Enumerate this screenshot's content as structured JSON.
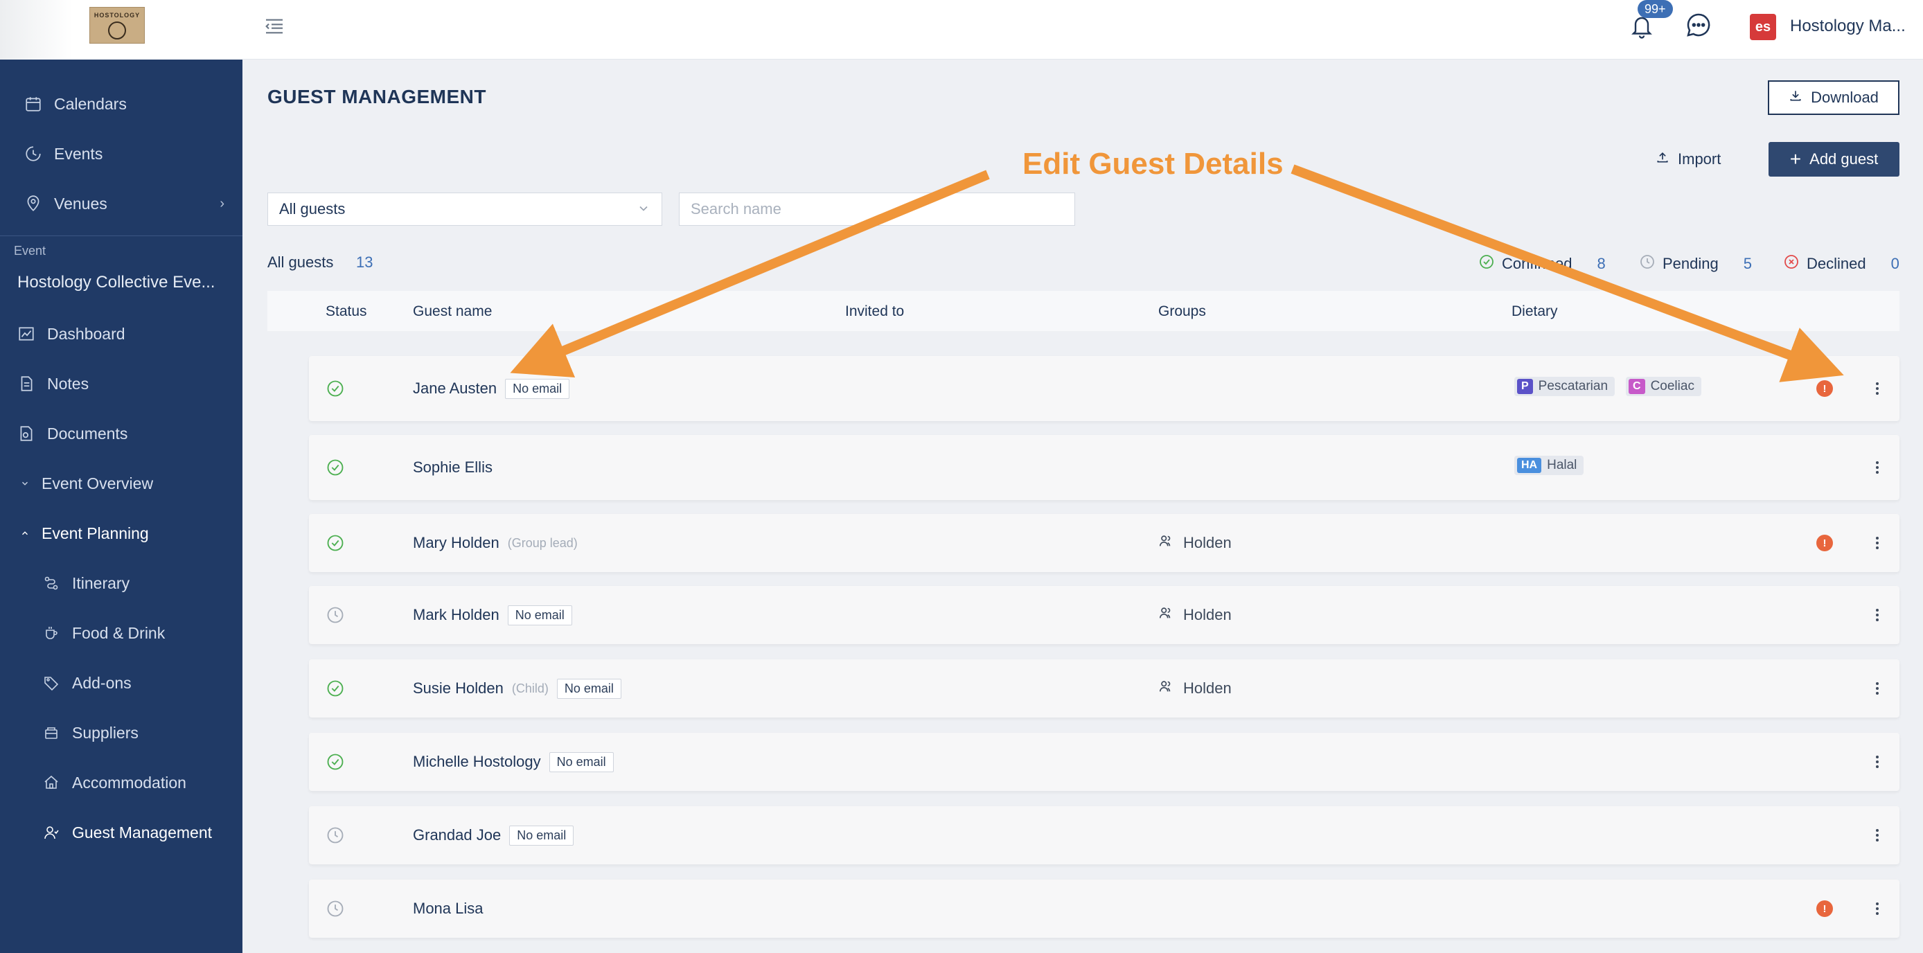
{
  "sidebar": {
    "logo_text": "HOSTOLOGY",
    "items_top": [
      {
        "label": "Calendars",
        "icon": "calendar-icon"
      },
      {
        "label": "Events",
        "icon": "events-icon"
      },
      {
        "label": "Venues",
        "icon": "location-pin-icon"
      }
    ],
    "section_label": "Event",
    "event_name": "Hostology Collective Eve...",
    "items_event": [
      {
        "label": "Dashboard"
      },
      {
        "label": "Notes"
      },
      {
        "label": "Documents"
      },
      {
        "label": "Event Overview"
      },
      {
        "label": "Event Planning"
      }
    ],
    "items_planning": [
      {
        "label": "Itinerary"
      },
      {
        "label": "Food & Drink"
      },
      {
        "label": "Add-ons"
      },
      {
        "label": "Suppliers"
      },
      {
        "label": "Accommodation"
      },
      {
        "label": "Guest Management"
      }
    ]
  },
  "topbar": {
    "notification_count": "99+",
    "user_initials": "es",
    "user_name": "Hostology Ma..."
  },
  "page": {
    "title": "GUEST MANAGEMENT",
    "download_label": "Download",
    "import_label": "Import",
    "add_label": "Add guest",
    "filter_value": "All guests",
    "search_placeholder": "Search name"
  },
  "summary": {
    "all_label": "All guests",
    "all_count": "13",
    "confirmed_label": "Confirmed",
    "confirmed_count": "8",
    "pending_label": "Pending",
    "pending_count": "5",
    "declined_label": "Declined",
    "declined_count": "0"
  },
  "table": {
    "headers": [
      "Status",
      "Guest name",
      "Invited to",
      "Groups",
      "Dietary"
    ],
    "no_email_label": "No email",
    "rows": [
      {
        "name": "Jane Austen",
        "status": "confirmed",
        "note": "",
        "no_email": true,
        "group": "",
        "dietary": [
          {
            "abbr": "P",
            "label": "Pescatarian",
            "color": "#5b52c8"
          },
          {
            "abbr": "C",
            "label": "Coeliac",
            "color": "#c75ac9"
          }
        ],
        "warn": true
      },
      {
        "name": "Sophie Ellis",
        "status": "confirmed",
        "note": "",
        "no_email": false,
        "group": "",
        "dietary": [
          {
            "abbr": "HA",
            "label": "Halal",
            "color": "#4a8fde"
          }
        ],
        "warn": false
      },
      {
        "name": "Mary Holden",
        "status": "confirmed",
        "note": "(Group lead)",
        "no_email": false,
        "group": "Holden",
        "dietary": [],
        "warn": true
      },
      {
        "name": "Mark Holden",
        "status": "pending",
        "note": "",
        "no_email": true,
        "group": "Holden",
        "dietary": [],
        "warn": false
      },
      {
        "name": "Susie Holden",
        "status": "confirmed",
        "note": "(Child)",
        "no_email": true,
        "group": "Holden",
        "dietary": [],
        "warn": false
      },
      {
        "name": "Michelle Hostology",
        "status": "confirmed",
        "note": "",
        "no_email": true,
        "group": "",
        "dietary": [],
        "warn": false
      },
      {
        "name": "Grandad Joe",
        "status": "pending",
        "note": "",
        "no_email": true,
        "group": "",
        "dietary": [],
        "warn": false
      },
      {
        "name": "Mona Lisa",
        "status": "pending",
        "note": "",
        "no_email": false,
        "group": "",
        "dietary": [],
        "warn": true
      }
    ]
  },
  "annotation": {
    "text": "Edit Guest Details",
    "color": "#f0963a"
  },
  "colors": {
    "sidebar_bg": "#203a66",
    "accent": "#3d6fb5",
    "confirmed": "#4caf50",
    "pending": "#a6adb8",
    "declined": "#e24a4a",
    "warning": "#e8663d"
  }
}
